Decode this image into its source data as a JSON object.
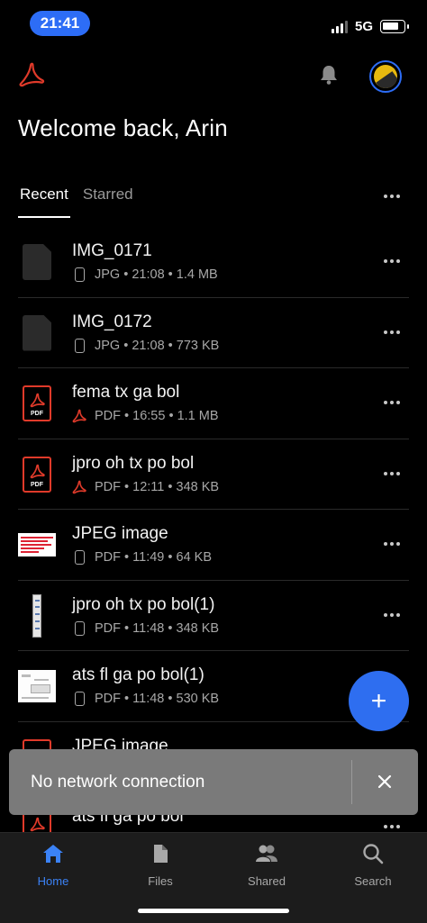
{
  "status_bar": {
    "time": "21:41",
    "network": "5G"
  },
  "header": {
    "logo_icon": "adobe-acrobat-logo",
    "notification_icon": "bell-icon",
    "welcome": "Welcome back, Arin"
  },
  "tabs": [
    {
      "label": "Recent",
      "active": true
    },
    {
      "label": "Starred",
      "active": false
    }
  ],
  "files": [
    {
      "name": "IMG_0171",
      "source_icon": "phone-icon",
      "type": "JPG",
      "time": "21:08",
      "size": "1.4 MB",
      "thumb": "generic"
    },
    {
      "name": "IMG_0172",
      "source_icon": "phone-icon",
      "type": "JPG",
      "time": "21:08",
      "size": "773 KB",
      "thumb": "generic"
    },
    {
      "name": "fema tx ga bol",
      "source_icon": "acrobat-icon",
      "type": "PDF",
      "time": "16:55",
      "size": "1.1 MB",
      "thumb": "pdf"
    },
    {
      "name": "jpro oh tx po bol",
      "source_icon": "acrobat-icon",
      "type": "PDF",
      "time": "12:11",
      "size": "348 KB",
      "thumb": "pdf"
    },
    {
      "name": "JPEG image",
      "source_icon": "phone-icon",
      "type": "PDF",
      "time": "11:49",
      "size": "64 KB",
      "thumb": "image-a"
    },
    {
      "name": "jpro oh tx po bol(1)",
      "source_icon": "phone-icon",
      "type": "PDF",
      "time": "11:48",
      "size": "348 KB",
      "thumb": "image-b"
    },
    {
      "name": "ats fl ga po bol(1)",
      "source_icon": "phone-icon",
      "type": "PDF",
      "time": "11:48",
      "size": "530 KB",
      "thumb": "image-c"
    },
    {
      "name": "JPEG image",
      "thumb": "pdf"
    },
    {
      "name": "ats fl ga po bol",
      "thumb": "pdf"
    }
  ],
  "fab": {
    "label": "+"
  },
  "snackbar": {
    "message": "No network connection"
  },
  "bottom_nav": [
    {
      "label": "Home",
      "icon": "home-icon",
      "active": true
    },
    {
      "label": "Files",
      "icon": "file-icon",
      "active": false
    },
    {
      "label": "Shared",
      "icon": "people-icon",
      "active": false
    },
    {
      "label": "Search",
      "icon": "search-icon",
      "active": false
    }
  ],
  "colors": {
    "accent": "#2e6ef0",
    "pdf_red": "#e03a2a",
    "background": "#000000"
  }
}
